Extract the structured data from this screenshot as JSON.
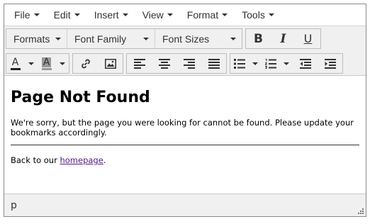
{
  "menubar": {
    "items": [
      "File",
      "Edit",
      "Insert",
      "View",
      "Format",
      "Tools"
    ]
  },
  "toolbar": {
    "formats_label": "Formats",
    "font_family_label": "Font Family",
    "font_sizes_label": "Font Sizes",
    "bold_glyph": "B",
    "italic_glyph": "I",
    "underline_glyph": "U",
    "text_color_glyph": "A",
    "background_color_glyph": "A",
    "text_color": "#222222",
    "background_color": "#999999"
  },
  "content": {
    "heading": "Page Not Found",
    "paragraph": "We're sorry, but the page you were looking for cannot be found. Please update your bookmarks accordingly.",
    "back_prefix": "Back to our ",
    "back_link": "homepage",
    "back_suffix": "."
  },
  "statusbar": {
    "path": "p"
  }
}
